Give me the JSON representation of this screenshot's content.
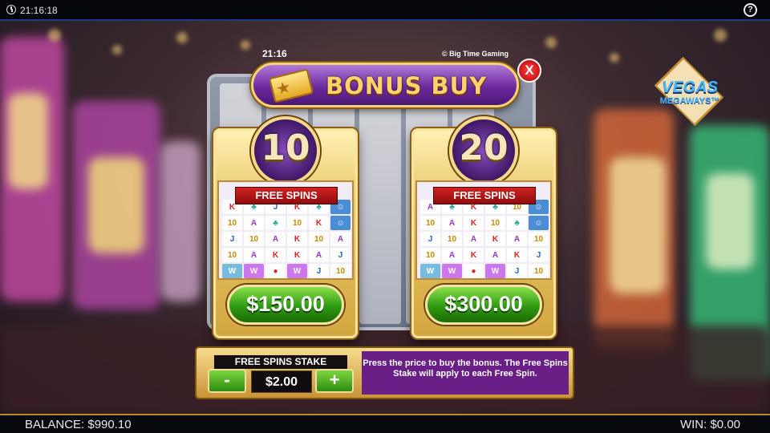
{
  "topbar": {
    "time": "21:16:18",
    "help_label": "?"
  },
  "dialog": {
    "game_time": "21:16",
    "credit": "© Big Time Gaming",
    "title": "BONUS BUY",
    "close_label": "X"
  },
  "logo": {
    "line1": "VEGAS",
    "line2": "MEGAWAYS™"
  },
  "offers": [
    {
      "spins": "10",
      "label": "FREE SPINS",
      "price": "$150.00"
    },
    {
      "spins": "20",
      "label": "FREE SPINS",
      "price": "$300.00"
    }
  ],
  "stake": {
    "label": "FREE SPINS STAKE",
    "minus_label": "-",
    "value": "$2.00",
    "plus_label": "+",
    "info": "Press the price to buy the bonus. The Free Spins Stake will apply to each Free Spin."
  },
  "bottombar": {
    "balance": "BALANCE: $990.10",
    "win": "WIN: $0.00"
  },
  "colors": {
    "accent_purple": "#6d2a9e",
    "gold": "#f4d27a",
    "green": "#2f9a12",
    "red": "#d32222"
  }
}
